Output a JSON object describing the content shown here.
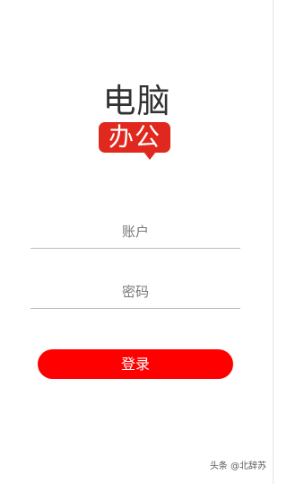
{
  "logo": {
    "top_text": "电脑",
    "badge_text": "办公",
    "badge_color": "#e1281e"
  },
  "form": {
    "username_placeholder": "账户",
    "password_placeholder": "密码",
    "login_label": "登录"
  },
  "colors": {
    "accent": "#ff0000",
    "divider": "#bdbdbd"
  },
  "watermark": "头条 @北辞苏"
}
